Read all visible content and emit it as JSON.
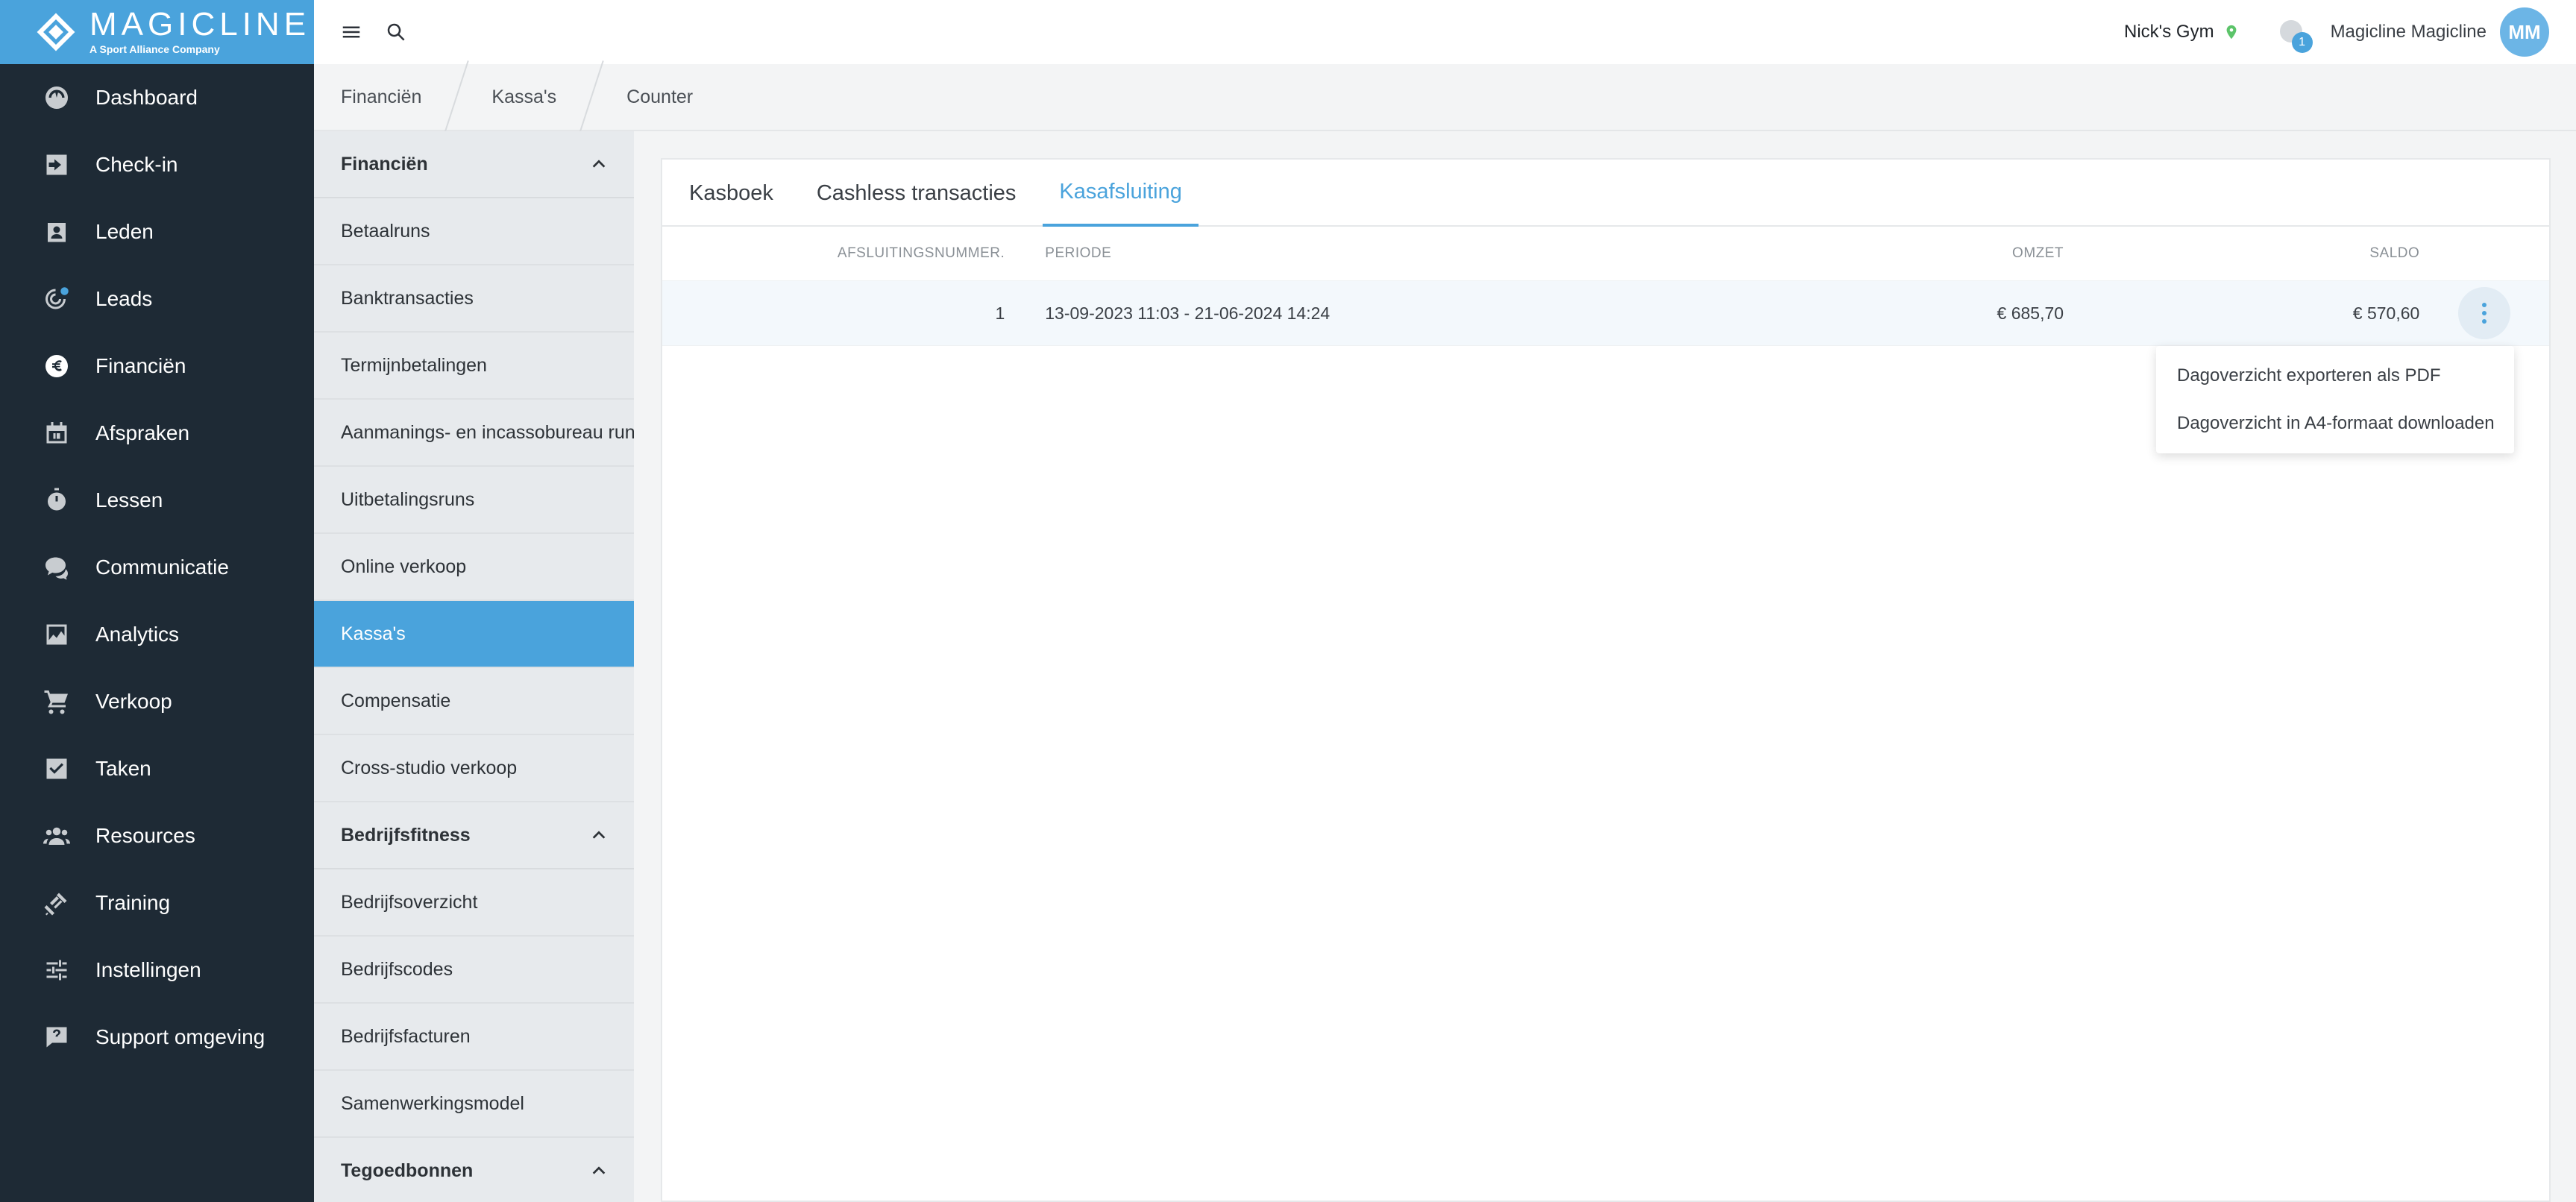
{
  "brand": {
    "name": "MAGICLINE",
    "tagline": "A Sport Alliance Company",
    "accent_color": "#4aa3dc"
  },
  "sidebar": {
    "items": [
      {
        "label": "Dashboard",
        "icon": "dashboard-icon"
      },
      {
        "label": "Check-in",
        "icon": "check-in-icon"
      },
      {
        "label": "Leden",
        "icon": "members-icon"
      },
      {
        "label": "Leads",
        "icon": "leads-icon"
      },
      {
        "label": "Financiën",
        "icon": "euro-icon",
        "active": true
      },
      {
        "label": "Afspraken",
        "icon": "calendar-icon"
      },
      {
        "label": "Lessen",
        "icon": "stopwatch-icon"
      },
      {
        "label": "Communicatie",
        "icon": "chat-icon"
      },
      {
        "label": "Analytics",
        "icon": "chart-icon"
      },
      {
        "label": "Verkoop",
        "icon": "cart-icon"
      },
      {
        "label": "Taken",
        "icon": "checkbox-icon"
      },
      {
        "label": "Resources",
        "icon": "group-icon"
      },
      {
        "label": "Training",
        "icon": "dumbbell-icon"
      },
      {
        "label": "Instellingen",
        "icon": "sliders-icon"
      },
      {
        "label": "Support omgeving",
        "icon": "support-icon"
      }
    ]
  },
  "topbar": {
    "gym_name": "Nick's Gym",
    "notification_count": "1",
    "user_name": "Magicline Magicline",
    "avatar_initials": "MM"
  },
  "breadcrumb": [
    "Financiën",
    "Kassa's",
    "Counter"
  ],
  "submenu": {
    "sections": [
      {
        "title": "Financiën",
        "items": [
          {
            "label": "Betaalruns"
          },
          {
            "label": "Banktransacties"
          },
          {
            "label": "Termijnbetalingen"
          },
          {
            "label": "Aanmanings- en incassobureau run"
          },
          {
            "label": "Uitbetalingsruns"
          },
          {
            "label": "Online verkoop"
          },
          {
            "label": "Kassa's",
            "active": true
          },
          {
            "label": "Compensatie"
          },
          {
            "label": "Cross-studio verkoop"
          }
        ]
      },
      {
        "title": "Bedrijfsfitness",
        "items": [
          {
            "label": "Bedrijfsoverzicht"
          },
          {
            "label": "Bedrijfscodes"
          },
          {
            "label": "Bedrijfsfacturen"
          },
          {
            "label": "Samenwerkingsmodel"
          }
        ]
      },
      {
        "title": "Tegoedbonnen",
        "items": []
      }
    ]
  },
  "main": {
    "tabs": [
      {
        "label": "Kasboek"
      },
      {
        "label": "Cashless transacties"
      },
      {
        "label": "Kasafsluiting",
        "active": true
      }
    ],
    "table": {
      "columns": [
        "AFSLUITINGSNUMMER.",
        "PERIODE",
        "OMZET",
        "SALDO"
      ],
      "rows": [
        {
          "number": "1",
          "period": "13-09-2023 11:03 - 21-06-2024 14:24",
          "revenue": "€ 685,70",
          "balance": "€ 570,60"
        }
      ]
    },
    "row_menu": [
      "Dagoverzicht exporteren als PDF",
      "Dagoverzicht in A4-formaat downloaden"
    ]
  }
}
